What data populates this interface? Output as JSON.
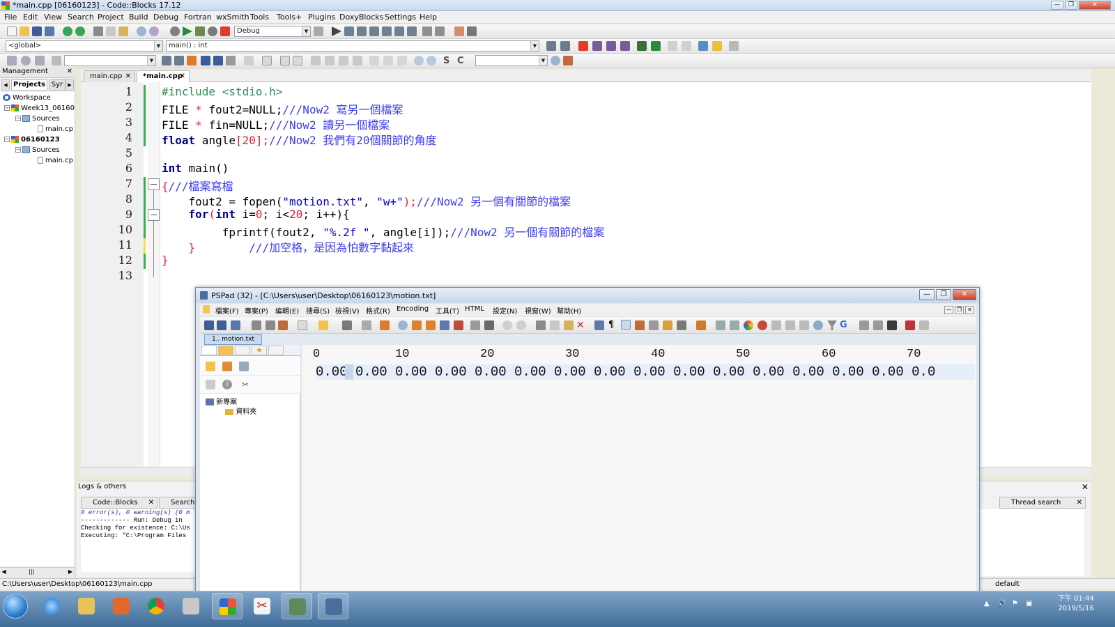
{
  "codeblocks": {
    "title": "*main.cpp [06160123] - Code::Blocks 17.12",
    "menu": [
      "File",
      "Edit",
      "View",
      "Search",
      "Project",
      "Build",
      "Debug",
      "Fortran",
      "wxSmith",
      "Tools",
      "Tools+",
      "Plugins",
      "DoxyBlocks",
      "Settings",
      "Help"
    ],
    "build_target": "Debug",
    "scope_combo": "<global>",
    "function_combo": "main() : int",
    "management": {
      "title": "Management",
      "tabs": [
        "Projects",
        "Syr"
      ],
      "tree": [
        "Workspace",
        "Week13_06160",
        "Sources",
        "main.cp",
        "06160123",
        "Sources",
        "main.cp"
      ]
    },
    "editor_tabs": [
      "main.cpp",
      "*main.cpp"
    ],
    "line_numbers": [
      "1",
      "2",
      "3",
      "4",
      "5",
      "6",
      "7",
      "8",
      "9",
      "10",
      "11",
      "12",
      "13"
    ],
    "code": {
      "l1": "#include <stdio.h>",
      "l2a": "FILE ",
      "l2b": "*",
      "l2c": " fout2=NULL;",
      "l2d": "///Now2 寫另一個檔案",
      "l3a": "FILE ",
      "l3b": "*",
      "l3c": " fin=NULL;",
      "l3d": "///Now2 讀另一個檔案",
      "l4a": "float",
      "l4b": " angle",
      "l4c": "[20];",
      "l4d": "///Now2 我們有20個關節的角度",
      "l6a": "int",
      "l6b": " main()",
      "l7a": "{",
      "l7b": "///檔案寫檔",
      "l8a": "    fout2 = fopen(",
      "l8b": "\"motion.txt\"",
      "l8c": ", ",
      "l8d": "\"w+\"",
      "l8e": ");",
      "l8f": "///Now2 另一個有關節的檔案",
      "l9a": "    ",
      "l9b": "for",
      "l9c": "(",
      "l9d": "int",
      "l9e": " i=",
      "l9f": "0",
      "l9g": "; i<",
      "l9h": "20",
      "l9i": "; i++){",
      "l10a": "         fprintf(fout2, ",
      "l10b": "\"%.2f \"",
      "l10c": ", angle[i]);",
      "l10d": "///Now2 另一個有關節的檔案",
      "l11a": "    }",
      "l11b": "        ///加空格，是因為怕數字黏起來",
      "l12": "}"
    },
    "logs": {
      "title": "Logs & others",
      "tabs": [
        "Code::Blocks",
        "Search",
        "Thread search"
      ],
      "lines": [
        "0 error(s), 0 warning(s) (0 m",
        "",
        "------------- Run: Debug in",
        "",
        "Checking for existence: C:\\Us",
        "Executing: \"C:\\Program Files"
      ]
    },
    "status_path": "C:\\Users\\user\\Desktop\\06160123\\main.cpp",
    "status_right": "default"
  },
  "pspad": {
    "title": "PSPad (32) - [C:\\Users\\user\\Desktop\\06160123\\motion.txt]",
    "menu": [
      "檔案(F)",
      "專案(P)",
      "編輯(E)",
      "搜尋(S)",
      "檢視(V)",
      "格式(R)",
      "Encoding",
      "工具(T)",
      "HTML",
      "設定(N)",
      "視窗(W)",
      "幫助(H)"
    ],
    "file_tab": "1.. motion.txt",
    "project_tree": [
      "新專案",
      "資料夾"
    ],
    "ruler": [
      "0",
      "10",
      "20",
      "30",
      "40",
      "50",
      "60",
      "70"
    ],
    "content_line": "0.00 0.00 0.00 0.00 0.00 0.00 0.00 0.00 0.00 0.00 0.00 0.00 0.00 0.00 0.00 0.0"
  },
  "taskbar": {
    "time": "下午 01:44",
    "date": "2019/5/16"
  }
}
